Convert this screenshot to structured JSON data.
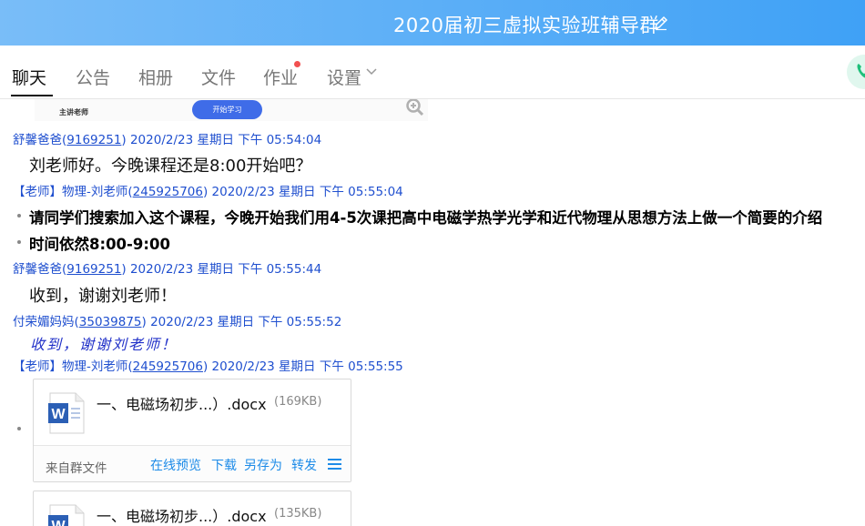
{
  "window": {
    "title": "2020届初三虚拟实验班辅导群"
  },
  "tabs": [
    {
      "label": "聊天",
      "active": true
    },
    {
      "label": "公告"
    },
    {
      "label": "相册"
    },
    {
      "label": "文件"
    },
    {
      "label": "作业",
      "has_dot": true
    },
    {
      "label": "设置",
      "has_dropdown": true
    }
  ],
  "preview_image": {
    "teacher_label": "主讲老师",
    "button_label": "开始学习"
  },
  "messages": [
    {
      "sender": "舒馨爸爸",
      "uid": "9169251",
      "time": "2020/2/23 星期日 下午 05:54:04",
      "text": "刘老师好。今晚课程还是8:00开始吧？"
    },
    {
      "sender": "【老师】物理-刘老师",
      "uid": "245925706",
      "time": "2020/2/23 星期日 下午 05:55:04",
      "lines": [
        "请同学们搜索加入这个课程，今晚开始我们用4-5次课把高中电磁学热学光学和近代物理从思想方法上做一个简要的介绍",
        "时间依然8:00-9:00"
      ]
    },
    {
      "sender": "舒馨爸爸",
      "uid": "9169251",
      "time": "2020/2/23 星期日 下午 05:55:44",
      "text": "收到，谢谢刘老师！"
    },
    {
      "sender": "付荣媚妈妈",
      "uid": "35039875",
      "time": "2020/2/23 星期日 下午 05:55:52",
      "text": "收到，谢谢刘老师！"
    },
    {
      "sender": "【老师】物理-刘老师",
      "uid": "245925706",
      "time": "2020/2/23 星期日 下午 05:55:55"
    }
  ],
  "files": [
    {
      "name": "一、电磁场初步...）.docx",
      "size": "(169KB)",
      "source": "来自群文件",
      "actions": [
        "在线预览",
        "下载",
        "另存为",
        "转发"
      ]
    },
    {
      "name": "一、电磁场初步...）.docx",
      "size": "(135KB)"
    }
  ],
  "colors": {
    "title_bar": "#4aa6f7",
    "link": "#1f4fcf",
    "file_action": "#1d8be8",
    "word_icon": "#2b5fb5"
  }
}
